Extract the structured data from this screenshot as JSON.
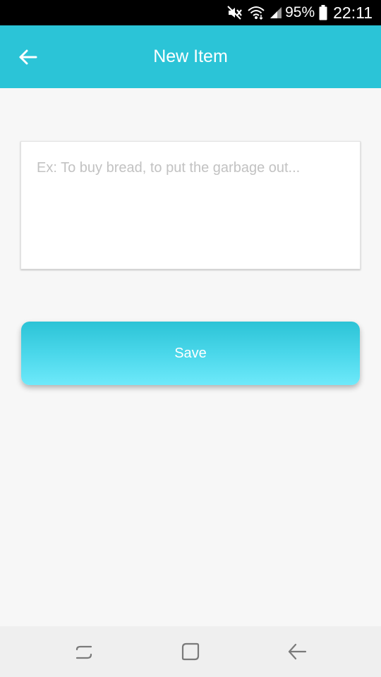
{
  "status_bar": {
    "battery_percent": "95%",
    "time": "22:11",
    "icons": [
      "mute-icon",
      "wifi-icon",
      "signal-icon",
      "battery-icon"
    ]
  },
  "app_bar": {
    "title": "New Item",
    "back_icon": "back-arrow-icon",
    "background_color": "#2bc4d7"
  },
  "form": {
    "item_placeholder": "Ex: To buy bread, to put the garbage out...",
    "item_value": "",
    "save_label": "Save"
  },
  "nav_bar": {
    "buttons": [
      "recent-apps-icon",
      "home-icon",
      "back-icon"
    ]
  }
}
